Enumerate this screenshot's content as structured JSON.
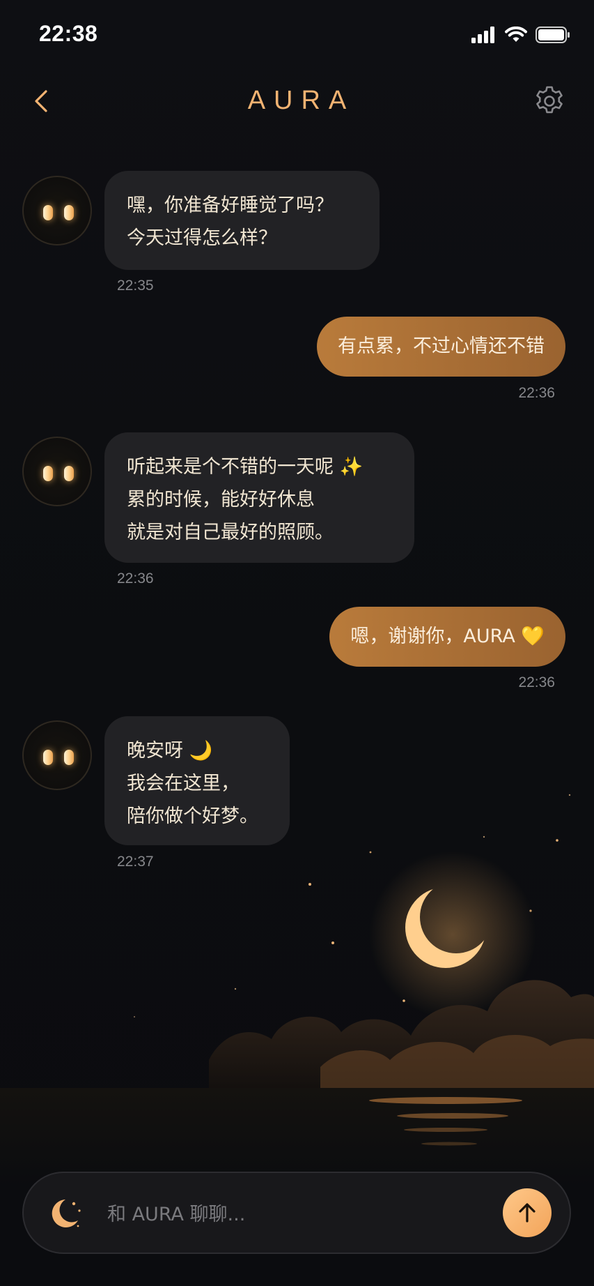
{
  "status_bar": {
    "time": "22:38"
  },
  "header": {
    "title": "AURA"
  },
  "messages": [
    {
      "sender": "ai",
      "text": "嘿，你准备好睡觉了吗？\n今天过得怎么样？",
      "time": "22:35"
    },
    {
      "sender": "user",
      "text": "有点累，不过心情还不错",
      "time": "22:36"
    },
    {
      "sender": "ai",
      "text": "听起来是个不错的一天呢 ✨\n累的时候，能好好休息\n就是对自己最好的照顾。",
      "time": "22:36"
    },
    {
      "sender": "user",
      "text": "嗯，谢谢你，AURA 💛",
      "time": "22:36"
    },
    {
      "sender": "ai",
      "text": "晚安呀 🌙\n我会在这里，\n陪你做个好梦。",
      "time": "22:37"
    }
  ],
  "input": {
    "placeholder": "和 AURA 聊聊..."
  },
  "colors": {
    "accent": "#f2b372",
    "user_bubble": "#b97b3b",
    "ai_bubble": "#222225",
    "background": "#0d0e12",
    "send_button": "#f2a45a"
  },
  "icons": {
    "back": "chevron-left-icon",
    "settings": "gear-icon",
    "moon": "moon-stars-icon",
    "send": "arrow-up-icon"
  }
}
